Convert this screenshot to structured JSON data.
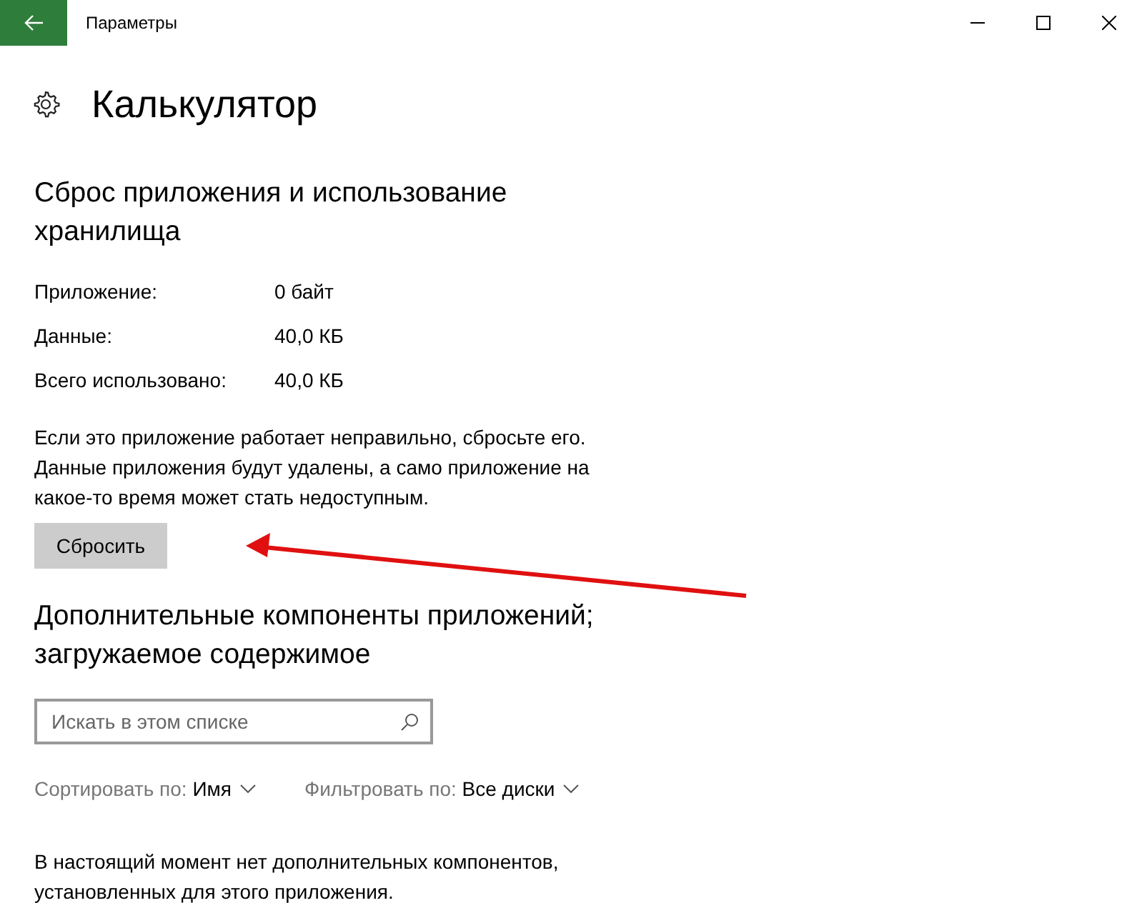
{
  "window": {
    "title": "Параметры"
  },
  "page": {
    "title": "Калькулятор"
  },
  "reset_section": {
    "heading": "Сброс приложения и использование хранилища",
    "storage": [
      {
        "label": "Приложение:",
        "value": "0 байт"
      },
      {
        "label": "Данные:",
        "value": "40,0 КБ"
      },
      {
        "label": "Всего использовано:",
        "value": "40,0 КБ"
      }
    ],
    "description": "Если это приложение работает неправильно, сбросьте его. Данные приложения будут удалены, а само приложение на какое-то время может стать недоступным.",
    "button": "Сбросить"
  },
  "addons_section": {
    "heading": "Дополнительные компоненты приложений; загружаемое содержимое",
    "search": {
      "placeholder": "Искать в этом списке"
    },
    "sort": {
      "label": "Сортировать по:",
      "value": "Имя"
    },
    "filter": {
      "label": "Фильтровать по:",
      "value": "Все диски"
    },
    "message": "В настоящий момент нет дополнительных компонентов, установленных для этого приложения."
  }
}
